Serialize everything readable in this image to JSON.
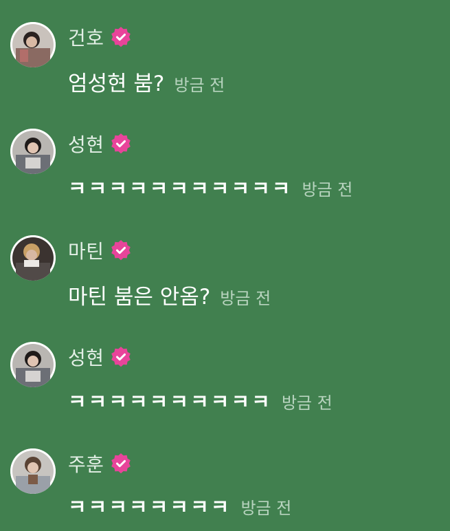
{
  "colors": {
    "background": "#41804F",
    "badge": "#E8449A",
    "time": "#B8D4BF"
  },
  "messages": [
    {
      "name": "건호",
      "text": "엄성현 붐?",
      "time": "방금 전",
      "avatar": "avatar-photo",
      "badge": "verified-badge-icon"
    },
    {
      "name": "성현",
      "text": "ㅋㅋㅋㅋㅋㅋㅋㅋㅋㅋㅋ",
      "time": "방금 전",
      "avatar": "avatar-photo",
      "badge": "verified-badge-icon"
    },
    {
      "name": "마틴",
      "text": "마틴 붐은 안옴?",
      "time": "방금 전",
      "avatar": "avatar-photo",
      "badge": "verified-badge-icon"
    },
    {
      "name": "성현",
      "text": "ㅋㅋㅋㅋㅋㅋㅋㅋㅋㅋ",
      "time": "방금 전",
      "avatar": "avatar-photo",
      "badge": "verified-badge-icon"
    },
    {
      "name": "주훈",
      "text": "ㅋㅋㅋㅋㅋㅋㅋㅋ",
      "time": "방금 전",
      "avatar": "avatar-photo",
      "badge": "verified-badge-icon"
    }
  ]
}
